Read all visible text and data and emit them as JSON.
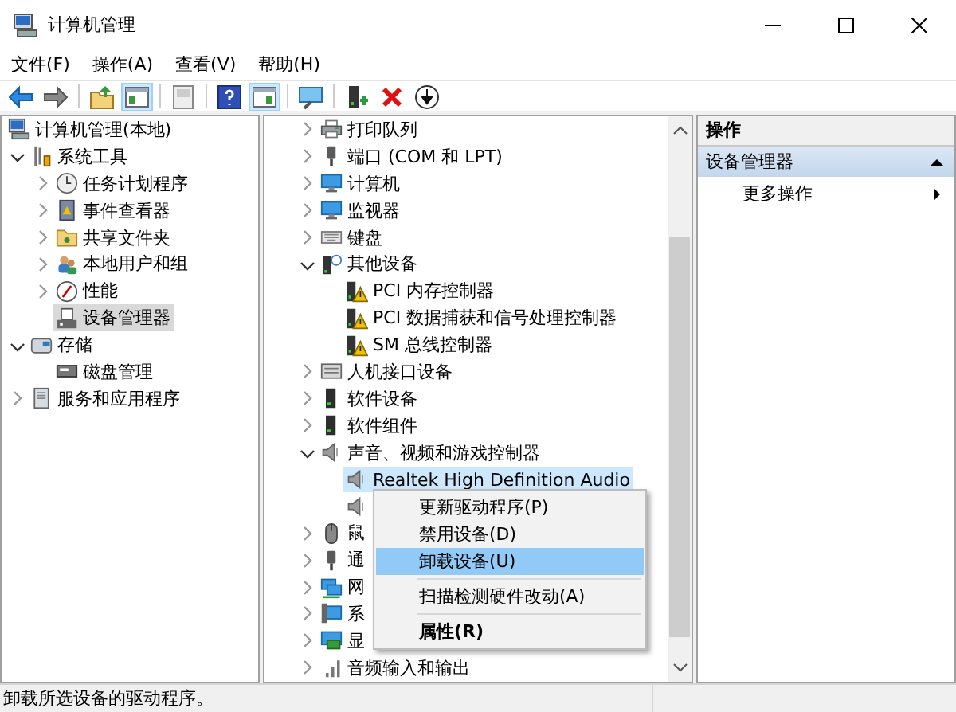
{
  "window": {
    "title": "计算机管理"
  },
  "menu": [
    "文件(F)",
    "操作(A)",
    "查看(V)",
    "帮助(H)"
  ],
  "toolbar": [
    {
      "pressed": false
    },
    {
      "pressed": false
    },
    {
      "pressed": false
    },
    {
      "pressed": true
    },
    {
      "pressed": false
    },
    {
      "pressed": false
    },
    {
      "pressed": true
    },
    {
      "pressed": false
    },
    {
      "pressed": false
    },
    {
      "pressed": false
    },
    {
      "pressed": false
    }
  ],
  "console_tree": {
    "items": [
      {
        "label": "计算机管理(本地)",
        "selected": false,
        "children": [
          {
            "label": "系统工具",
            "selected": false,
            "expanded": true,
            "children": [
              {
                "label": "任务计划程序",
                "selected": false,
                "expanded": false
              },
              {
                "label": "事件查看器",
                "selected": false,
                "expanded": false
              },
              {
                "label": "共享文件夹",
                "selected": false,
                "expanded": false
              },
              {
                "label": "本地用户和组",
                "selected": false,
                "expanded": false
              },
              {
                "label": "性能",
                "selected": false,
                "expanded": false
              },
              {
                "label": "设备管理器",
                "selected": true
              }
            ]
          },
          {
            "label": "存储",
            "selected": false,
            "expanded": true,
            "children": [
              {
                "label": "磁盘管理",
                "selected": false
              }
            ]
          },
          {
            "label": "服务和应用程序",
            "selected": false,
            "expanded": false
          }
        ]
      }
    ]
  },
  "device_tree": {
    "items": [
      {
        "label": "打印队列",
        "selected": false,
        "expanded": false
      },
      {
        "label": "端口 (COM 和 LPT)",
        "selected": false,
        "expanded": false
      },
      {
        "label": "计算机",
        "selected": false,
        "expanded": false
      },
      {
        "label": "监视器",
        "selected": false,
        "expanded": false
      },
      {
        "label": "键盘",
        "selected": false,
        "expanded": false
      },
      {
        "label": "其他设备",
        "selected": false,
        "expanded": true,
        "children": [
          {
            "label": "PCI 内存控制器",
            "selected": false
          },
          {
            "label": "PCI 数据捕获和信号处理控制器",
            "selected": false
          },
          {
            "label": "SM 总线控制器",
            "selected": false
          }
        ]
      },
      {
        "label": "人机接口设备",
        "selected": false,
        "expanded": false
      },
      {
        "label": "软件设备",
        "selected": false,
        "expanded": false
      },
      {
        "label": "软件组件",
        "selected": false,
        "expanded": false
      },
      {
        "label": "声音、视频和游戏控制器",
        "selected": false,
        "expanded": true,
        "children": [
          {
            "label": "Realtek High Definition Audio",
            "selected": true
          },
          {
            "selected": false
          }
        ]
      },
      {
        "label": "鼠",
        "selected": false,
        "expanded": false
      },
      {
        "label": "通",
        "selected": false,
        "expanded": false
      },
      {
        "label": "网",
        "selected": false,
        "expanded": false
      },
      {
        "label": "系",
        "selected": false,
        "expanded": false
      },
      {
        "label": "显",
        "selected": false,
        "expanded": false
      },
      {
        "label": "音频输入和输出",
        "selected": false,
        "expanded": false
      }
    ]
  },
  "actions": {
    "title": "操作",
    "sections": [
      {
        "label": "设备管理器",
        "expanded": true,
        "items": [
          {
            "label": "更多操作"
          }
        ]
      }
    ]
  },
  "context_menu": {
    "items": [
      {
        "label": "更新驱动程序(P)",
        "selected": false
      },
      {
        "label": "禁用设备(D)",
        "selected": false
      },
      {
        "label": "卸载设备(U)",
        "selected": true
      },
      {
        "label": "扫描检测硬件改动(A)",
        "selected": false,
        "separator_before": true
      },
      {
        "label": "属性(R)",
        "selected": false,
        "separator_before": true,
        "default": true
      }
    ]
  },
  "status_bar": "卸载所选设备的驱动程序。"
}
